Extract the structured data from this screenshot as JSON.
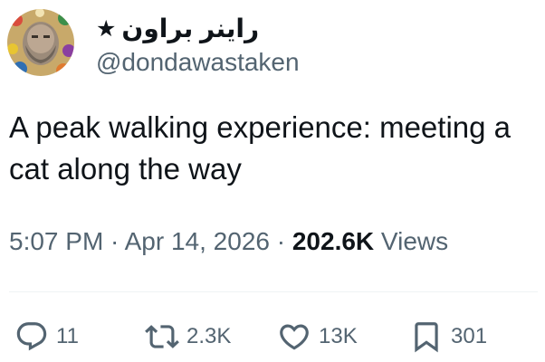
{
  "author": {
    "display_name": "راينر براون",
    "badge_symbol": "★",
    "handle": "@dondawastaken",
    "avatar_icon": "bearded-man-portrait-avatar"
  },
  "tweet": {
    "text": "A peak walking experience: meeting a cat along the way",
    "time": "5:07 PM",
    "separator1": " · ",
    "date": "Apr 14, 2026",
    "separator2": " · ",
    "views_count": "202.6K",
    "views_label": " Views"
  },
  "actions": {
    "reply_count": "11",
    "retweet_count": "2.3K",
    "like_count": "13K",
    "bookmark_count": "301"
  },
  "colors": {
    "text_primary": "#0f1419",
    "text_secondary": "#536471",
    "divider": "#eff3f4"
  }
}
